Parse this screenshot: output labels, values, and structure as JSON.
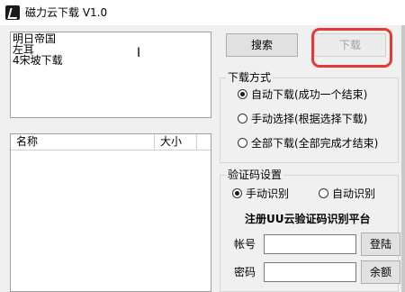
{
  "window": {
    "title": "磁力云下载 V1.0"
  },
  "textarea": {
    "content": "明日帝国\n左耳\n4宋坡下载"
  },
  "buttons": {
    "search": "搜索",
    "download": "下载",
    "login": "登陆",
    "balance": "余额"
  },
  "file_list": {
    "columns": [
      "名称",
      "大小"
    ],
    "rows": []
  },
  "download_mode": {
    "title": "下载方式",
    "options": [
      {
        "label": "自动下载(成功一个结束)",
        "checked": true
      },
      {
        "label": "手动选择(根据选择下载)",
        "checked": false
      },
      {
        "label": "全部下载(全部完成才结束)",
        "checked": false
      }
    ]
  },
  "captcha": {
    "title": "验证码设置",
    "options": [
      {
        "label": "手动识别",
        "checked": true
      },
      {
        "label": "自动识别",
        "checked": false
      }
    ],
    "platform": "注册UU云验证码识别平台",
    "account_label": "帐号",
    "account_value": "",
    "password_label": "密码",
    "password_value": ""
  }
}
